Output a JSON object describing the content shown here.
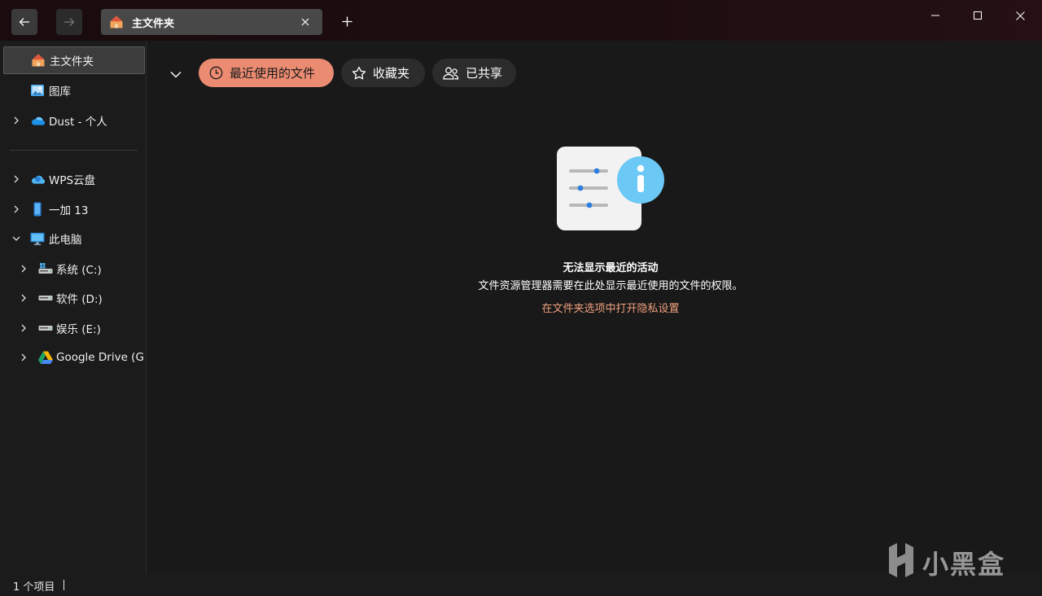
{
  "window": {
    "tab_title": "主文件夹",
    "accent_color": "#eb8c72",
    "link_color": "#f0a07e"
  },
  "toolbar": {
    "back_icon": "arrow-left-icon",
    "forward_icon": "arrow-right-icon",
    "new_tab_icon": "plus-icon",
    "close_tab_icon": "close-icon"
  },
  "sidebar": {
    "items": [
      {
        "label": "主文件夹",
        "icon": "home-icon"
      },
      {
        "label": "图库",
        "icon": "gallery-icon"
      },
      {
        "label": "Dust - 个人",
        "icon": "onedrive-cloud-icon"
      },
      {
        "label": "WPS云盘",
        "icon": "wps-cloud-icon"
      },
      {
        "label": "一加 13",
        "icon": "phone-icon"
      },
      {
        "label": "此电脑",
        "icon": "computer-icon"
      },
      {
        "label": "系统 (C:)",
        "icon": "system-drive-icon"
      },
      {
        "label": "软件 (D:)",
        "icon": "drive-icon"
      },
      {
        "label": "娱乐 (E:)",
        "icon": "drive-icon"
      },
      {
        "label": "Google Drive (G:",
        "icon": "google-drive-icon"
      }
    ]
  },
  "main": {
    "filters": [
      {
        "label": "最近使用的文件",
        "icon": "clock-icon",
        "selected": true
      },
      {
        "label": "收藏夹",
        "icon": "star-icon",
        "selected": false
      },
      {
        "label": "已共享",
        "icon": "people-icon",
        "selected": false
      }
    ],
    "empty_title": "无法显示最近的活动",
    "empty_description": "文件资源管理器需要在此处显示最近使用的文件的权限。",
    "empty_link": "在文件夹选项中打开隐私设置"
  },
  "status": {
    "item_count": "1 个项目"
  },
  "watermark": {
    "text": "小黑盒"
  }
}
